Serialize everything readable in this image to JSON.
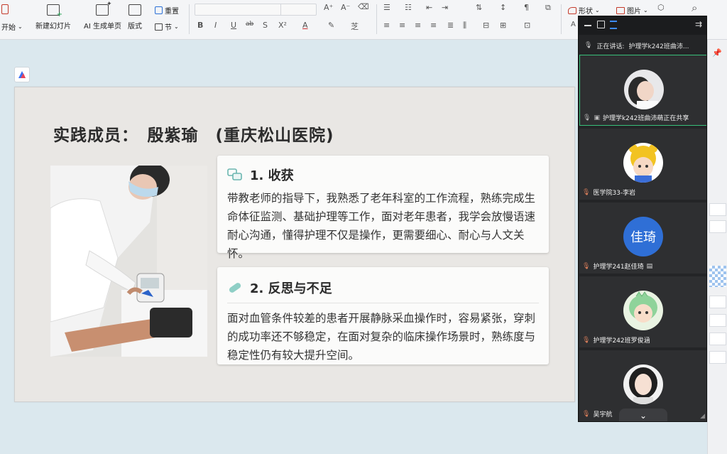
{
  "ribbon": {
    "start_label": "开始",
    "new_slide_label": "新建幻灯片",
    "ai_page_label": "AI 生成单页",
    "layout_label": "版式",
    "reset_label": "重置",
    "section_label": "节",
    "shape_label": "形状",
    "picture_label": "图片"
  },
  "slide": {
    "title": "实践成员：　殷紫瑜　(重庆松山医院)",
    "card1": {
      "heading": "1. 收获",
      "body": "带教老师的指导下，我熟悉了老年科室的工作流程，熟练完成生命体征监测、基础护理等工作，面对老年患者，我学会放慢语速耐心沟通，懂得护理不仅是操作，更需要细心、耐心与人文关怀。"
    },
    "card2": {
      "heading": "2. 反思与不足",
      "body": "面对血管条件较差的患者开展静脉采血操作时，容易紧张，穿刺的成功率还不够稳定，在面对复杂的临床操作场景时，熟练度与稳定性仍有较大提升空间。"
    }
  },
  "meeting": {
    "speaking_label": "正在讲话:",
    "speaking_name": "护理学k242班曲沛...",
    "participants": [
      {
        "name": "护理学k242班曲沛萌正在共享",
        "avatar": "photo-girl",
        "active": true
      },
      {
        "name": "医学院33-李岩",
        "avatar": "cartoon-bear"
      },
      {
        "name": "护理学241赵佳琦",
        "avatar": "text-initials",
        "initials": "佳琦",
        "color": "#2f6fd6"
      },
      {
        "name": "护理学242班罗俊涵",
        "avatar": "cartoon-dino"
      },
      {
        "name": "吴宇航",
        "avatar": "photo-girl-2"
      }
    ]
  },
  "colors": {
    "active_border": "#39c07a",
    "panel_bg": "#242527",
    "initials_bg": "#2f6fd6"
  }
}
